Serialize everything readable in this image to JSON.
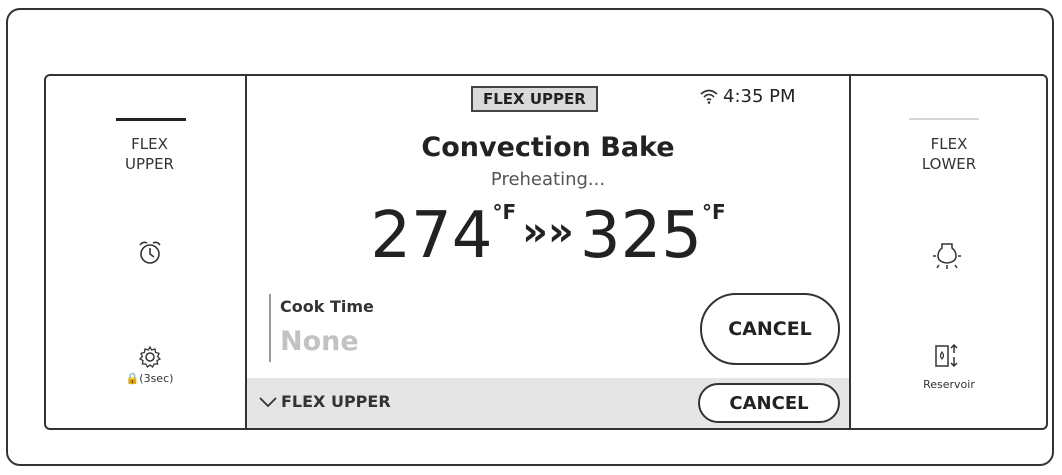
{
  "left": {
    "label_line1": "FLEX",
    "label_line2": "UPPER",
    "icons": [
      "alarm-clock-icon",
      "gear-icon"
    ],
    "lock_label": "🔒(3sec)"
  },
  "right": {
    "label_line1": "FLEX",
    "label_line2": "LOWER",
    "icons": [
      "oven-light-icon",
      "reservoir-icon"
    ],
    "reservoir_label": "Reservoir"
  },
  "center": {
    "zone_tab": "FLEX UPPER",
    "time": "4:35 PM",
    "mode": "Convection Bake",
    "status": "Preheating...",
    "current_temp": "274",
    "target_temp": "325",
    "temp_unit": "°F",
    "arrows": "»»",
    "cook_time_title": "Cook Time",
    "cook_time_value": "None",
    "cancel_label": "CANCEL"
  },
  "bottom": {
    "zone_label": "FLEX UPPER",
    "cancel_label": "CANCEL"
  },
  "colors": {
    "border": "#333333",
    "bottom_bar": "#e5e5e5",
    "tab_bg": "#d9d9d9",
    "muted_text": "#c2c2c2"
  }
}
